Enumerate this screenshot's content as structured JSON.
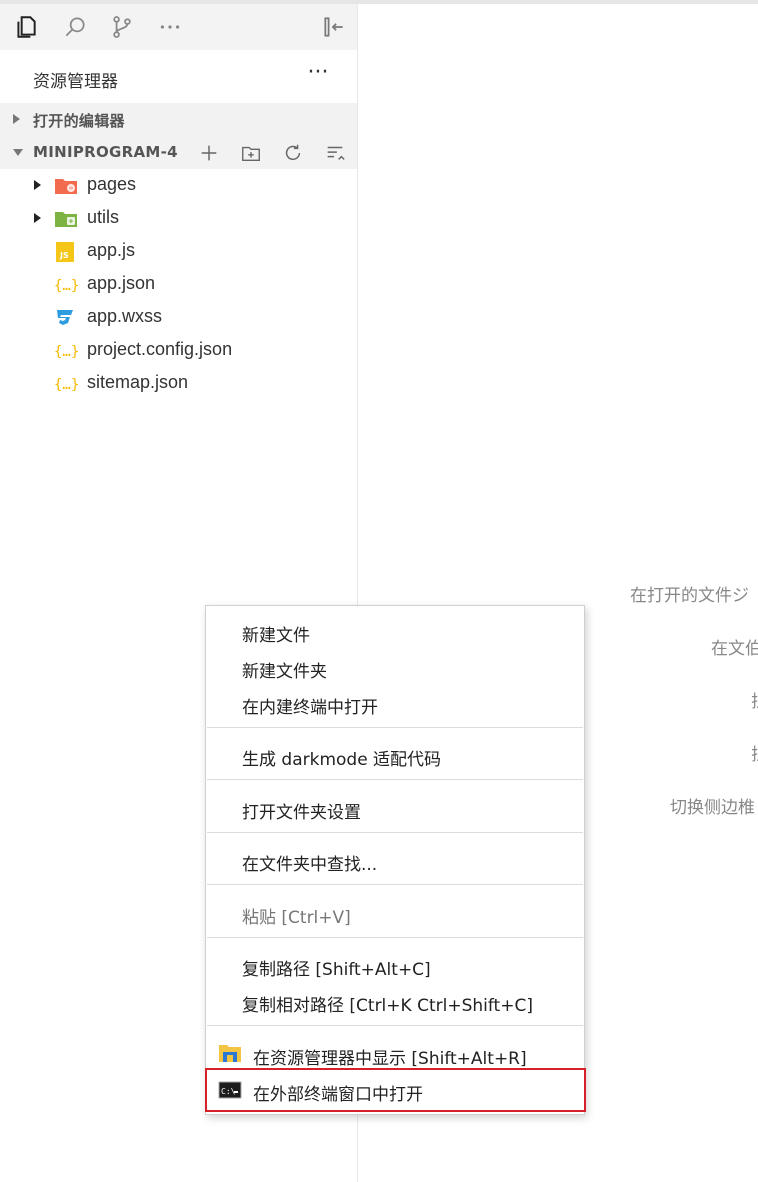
{
  "explorer": {
    "title": "资源管理器",
    "more": "···",
    "open_editors_label": "打开的编辑器",
    "project_label": "MINIPROGRAM-4"
  },
  "activity_icons": [
    "files-icon",
    "search-icon",
    "source-control-icon",
    "more-icon",
    "collapse-sidebar-icon"
  ],
  "tree": [
    {
      "label": "pages",
      "icon": "folder-pages-icon",
      "color": "#f26b4f",
      "expandable": true
    },
    {
      "label": "utils",
      "icon": "folder-utils-icon",
      "color": "#7cb342",
      "expandable": true
    },
    {
      "label": "app.js",
      "icon": "js-file-icon",
      "color": "#f5c518",
      "expandable": false
    },
    {
      "label": "app.json",
      "icon": "json-file-icon",
      "color": "#f5b800",
      "expandable": false
    },
    {
      "label": "app.wxss",
      "icon": "css-file-icon",
      "color": "#2d9de0",
      "expandable": false
    },
    {
      "label": "project.config.json",
      "icon": "json-file-icon",
      "color": "#f5b800",
      "expandable": false
    },
    {
      "label": "sitemap.json",
      "icon": "json-file-icon",
      "color": "#f5b800",
      "expandable": false
    }
  ],
  "editor_hints": [
    "在打开的文件ジ",
    "在文伯",
    "拉",
    "拉",
    "切换侧边椎"
  ],
  "context_menu": {
    "new_file": "新建文件",
    "new_folder": "新建文件夹",
    "open_in_terminal": "在内建终端中打开",
    "darkmode": "生成 darkmode 适配代码",
    "folder_settings": "打开文件夹设置",
    "find_in_folder": "在文件夹中查找...",
    "paste": "粘贴  [Ctrl+V]",
    "copy_path": "复制路径  [Shift+Alt+C]",
    "copy_relative_path": "复制相对路径  [Ctrl+K Ctrl+Shift+C]",
    "reveal_in_explorer": "在资源管理器中显示  [Shift+Alt+R]",
    "open_external_terminal": "在外部终端窗口中打开"
  },
  "colors": {
    "highlight_border": "#d71f2a",
    "section_bg": "#f2f2f2",
    "activity_bg": "#f3f3f3"
  }
}
